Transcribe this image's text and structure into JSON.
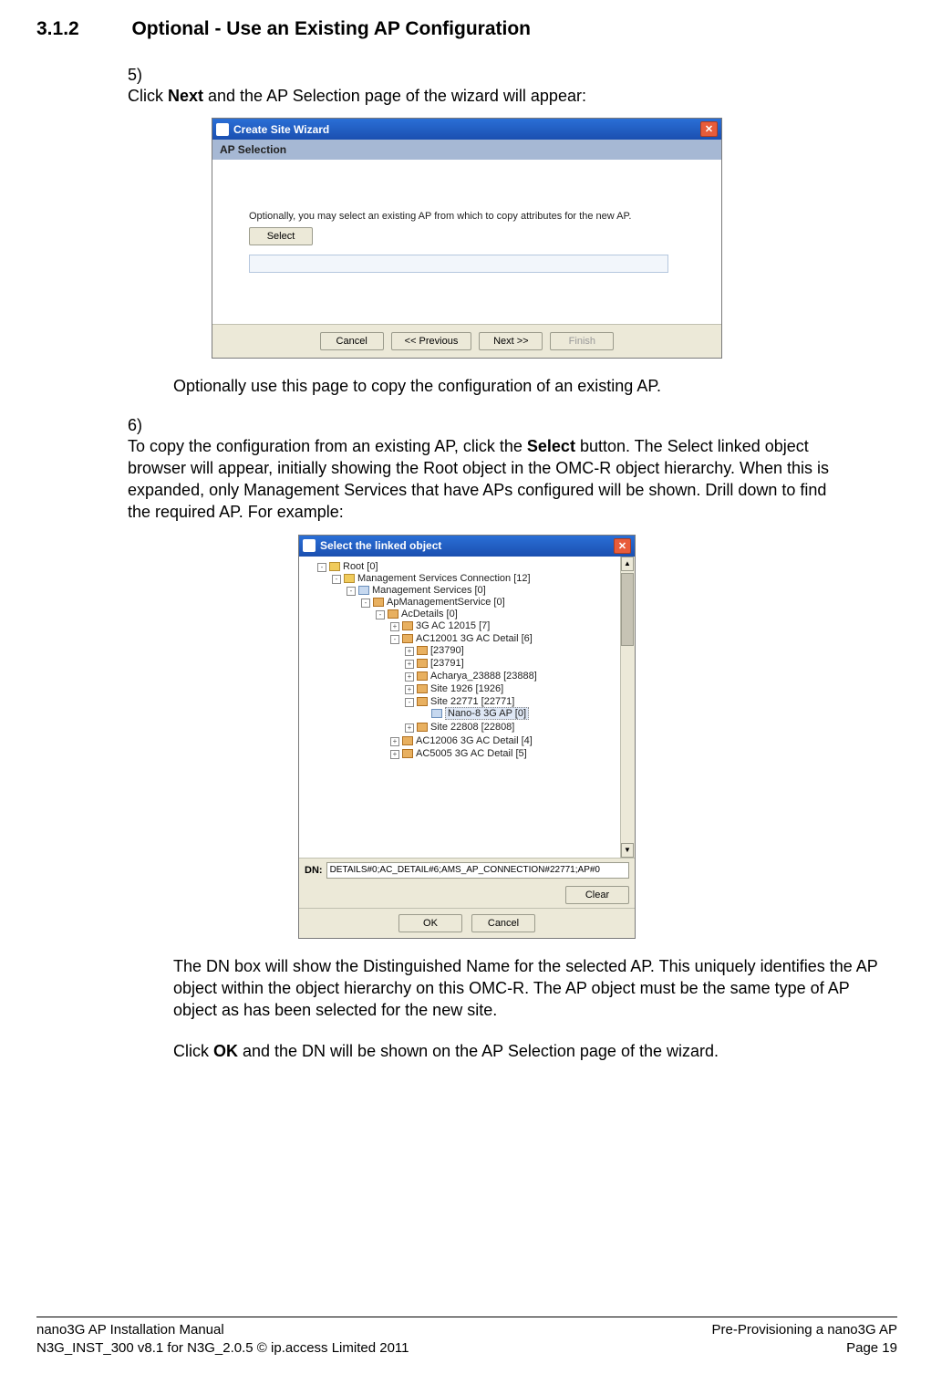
{
  "header": {
    "num": "3.1.2",
    "title": "Optional - Use an Existing AP Configuration"
  },
  "step5": {
    "num": "5)",
    "pre": "Click ",
    "bold": "Next",
    "post": " and the AP Selection page of the wizard will appear:"
  },
  "wizard1": {
    "title": "Create Site Wizard",
    "sub": "AP Selection",
    "body_text": "Optionally, you may select an existing AP from which to copy attributes for the new AP.",
    "select": "Select",
    "cancel": "Cancel",
    "prev": "<< Previous",
    "next": "Next >>",
    "finish": "Finish"
  },
  "para_after5": "Optionally use this page to copy the configuration of an existing AP.",
  "step6": {
    "num": "6)",
    "pre": "To copy the configuration from an existing AP, click the ",
    "bold": "Select",
    "post": " button. The Select linked object browser will appear, initially showing the Root object in the OMC-R object hierarchy. When this is expanded, only Management Services that have APs configured will be shown. Drill down to find the required AP. For example:"
  },
  "treewin": {
    "title": "Select the linked object",
    "dn_label": "DN:",
    "dn_value": "DETAILS#0;AC_DETAIL#6;AMS_AP_CONNECTION#22771;AP#0",
    "nodes": {
      "root": "Root [0]",
      "msc": "Management Services Connection [12]",
      "ms": "Management Services [0]",
      "ams": "ApManagementService [0]",
      "acd": "AcDetails [0]",
      "n1": "3G AC 12015 [7]",
      "n2": "AC12001 3G AC Detail [6]",
      "n2a": "[23790]",
      "n2b": "[23791]",
      "n2c": "Acharya_23888 [23888]",
      "n2d": "Site 1926 [1926]",
      "n2e": "Site 22771 [22771]",
      "n2e_sel": "Nano-8 3G AP [0]",
      "n2f": "Site 22808 [22808]",
      "n3": "AC12006 3G AC Detail [4]",
      "n4": "AC5005 3G AC Detail [5]"
    },
    "clear": "Clear",
    "ok": "OK",
    "cancel": "Cancel"
  },
  "para_after6a": "The DN box will show the Distinguished Name for the selected AP. This uniquely identifies the AP object within the object hierarchy on this OMC-R. The AP object must be the same type of AP object as has been selected for the new site.",
  "para_after6b_pre": "Click ",
  "para_after6b_bold": "OK",
  "para_after6b_post": " and the DN will be shown on the AP Selection page of the wizard.",
  "footer": {
    "l1": "nano3G AP Installation Manual",
    "l2": "N3G_INST_300 v8.1 for N3G_2.0.5 © ip.access Limited 2011",
    "r1": "Pre-Provisioning a nano3G AP",
    "r2": "Page 19"
  }
}
